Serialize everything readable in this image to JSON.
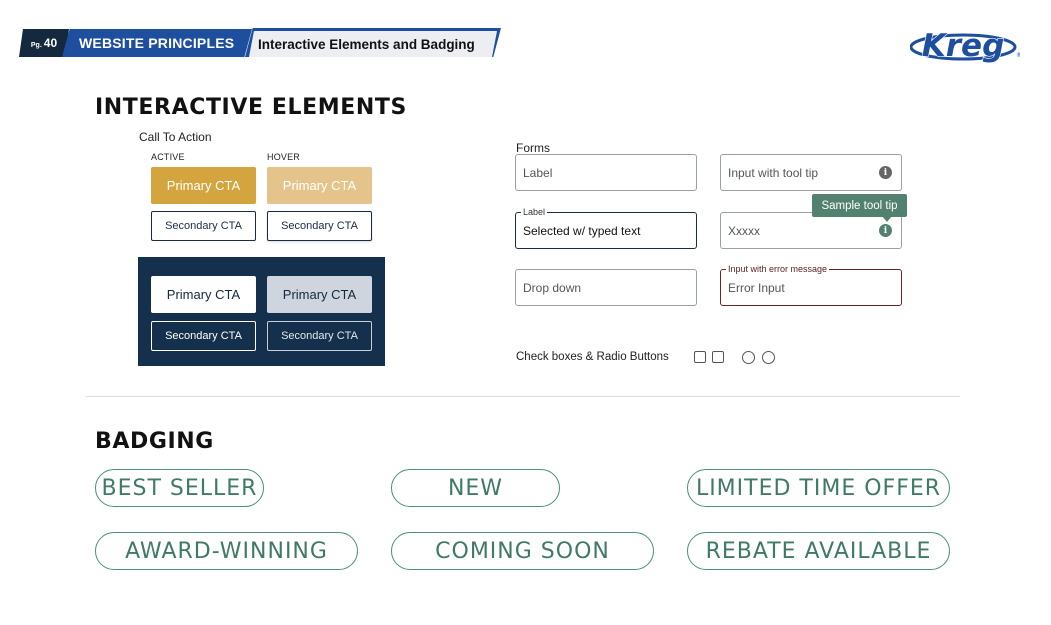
{
  "header": {
    "page_prefix": "Pg.",
    "page_number": "40",
    "section_title": "WEBSITE PRINCIPLES",
    "subtitle": "Interactive Elements and Badging",
    "logo_text": "Kreg",
    "logo_mark": "®"
  },
  "interactive": {
    "heading": "INTERACTIVE ELEMENTS",
    "cta_label": "Call To Action",
    "active_label": "ACTIVE",
    "hover_label": "HOVER",
    "light": {
      "primary_active": "Primary CTA",
      "primary_hover": "Primary CTA",
      "secondary_active": "Secondary CTA",
      "secondary_hover": "Secondary CTA"
    },
    "dark": {
      "primary_active": "Primary CTA",
      "primary_hover": "Primary CTA",
      "secondary_active": "Secondary CTA",
      "secondary_hover": "Secondary CTA"
    }
  },
  "forms": {
    "label": "Forms",
    "label_field": "Label",
    "tooltip_field": "Input with tool tip",
    "selected_legend": "Label",
    "selected_value": "Selected w/ typed text",
    "tooltip_text": "Sample tool tip",
    "tooltip_input_placeholder": "Xxxxx",
    "dropdown": "Drop down",
    "error_legend": "Input with error message",
    "error_value": "Error Input",
    "info_glyph": "i",
    "checkbox_label": "Check boxes & Radio Buttons"
  },
  "badging": {
    "heading": "BADGING",
    "badges": [
      "BEST SELLER",
      "NEW",
      "LIMITED TIME OFFER",
      "AWARD-WINNING",
      "COMING SOON",
      "REBATE AVAILABLE"
    ]
  },
  "colors": {
    "navy": "#14283e",
    "brand_blue": "#1e4f9f",
    "gold_active": "#d4a43f",
    "gold_hover": "#e4c48a",
    "badge_green": "#4d8f79",
    "tooltip_green": "#52826f",
    "error_red": "#6b2626"
  }
}
